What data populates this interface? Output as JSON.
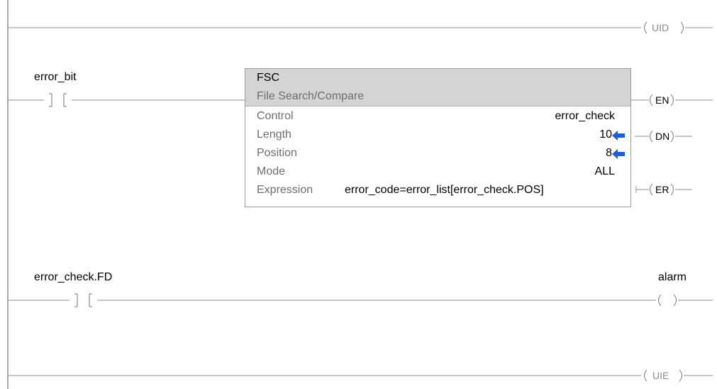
{
  "rungs": [
    {
      "output": {
        "label": "UID",
        "label_color": "grey"
      }
    },
    {
      "input": {
        "tag": "error_bit"
      },
      "instruction": {
        "mnemonic": "FSC",
        "description": "File Search/Compare",
        "params": [
          {
            "name": "Control",
            "value": "error_check",
            "arrow": false
          },
          {
            "name": "Length",
            "value": "10",
            "arrow": true
          },
          {
            "name": "Position",
            "value": "8",
            "arrow": true
          },
          {
            "name": "Mode",
            "value": "ALL",
            "arrow": false
          },
          {
            "name": "Expression",
            "value": "error_code=error_list[error_check.POS]",
            "arrow": false
          }
        ],
        "outputs": [
          "EN",
          "DN",
          "ER"
        ]
      }
    },
    {
      "input": {
        "tag": "error_check.FD"
      },
      "output": {
        "tag": "alarm",
        "label": ""
      }
    },
    {
      "output": {
        "label": "UIE",
        "label_color": "grey"
      }
    }
  ],
  "colors": {
    "rail": "#8f8f8f",
    "wire": "#6e6e6e",
    "contact": "#8a8a8a",
    "block_header": "#d4d4d4",
    "value_arrow": "#1f5fd6"
  }
}
